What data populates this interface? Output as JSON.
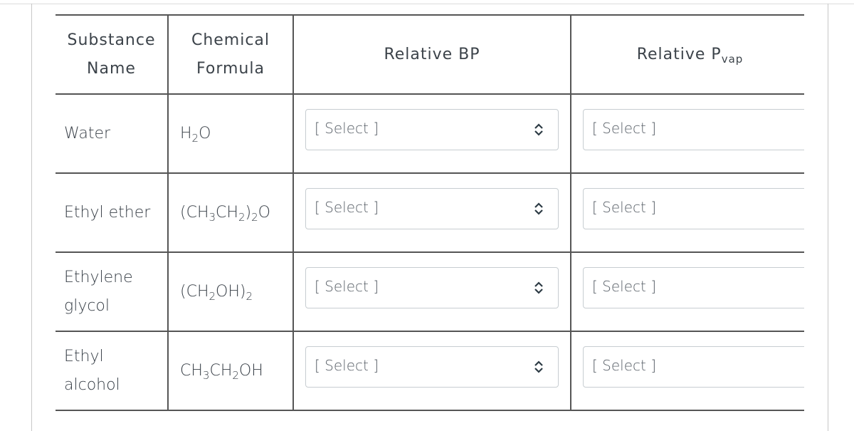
{
  "table": {
    "headers": {
      "substance_line1": "Substance",
      "substance_line2": "Name",
      "formula_line1": "Chemical",
      "formula_line2": "Formula",
      "relative_bp": "Relative BP",
      "relative_pvap_main": "Relative P",
      "relative_pvap_sub": "vap"
    },
    "rows": [
      {
        "name_line1": "Water",
        "name_line2": "",
        "formula_parts": [
          "H",
          "2",
          "O"
        ],
        "bp_select": "[ Select ]",
        "pvap_select": "[ Select ]"
      },
      {
        "name_line1": "Ethyl ether",
        "name_line2": "",
        "formula_parts": [
          "(CH",
          "3",
          "CH",
          "2",
          ")",
          "2",
          "O"
        ],
        "bp_select": "[ Select ]",
        "pvap_select": "[ Select ]"
      },
      {
        "name_line1": "Ethylene",
        "name_line2": "glycol",
        "formula_parts": [
          "(CH",
          "2",
          "OH)",
          "2"
        ],
        "bp_select": "[ Select ]",
        "pvap_select": "[ Select ]"
      },
      {
        "name_line1": "Ethyl",
        "name_line2": "alcohol",
        "formula_parts": [
          "CH",
          "3",
          "CH",
          "2",
          "OH"
        ],
        "bp_select": "[ Select ]",
        "pvap_select": "[ Select ]"
      }
    ]
  },
  "icons": {
    "select_arrow": "chevron-up-down-icon"
  }
}
